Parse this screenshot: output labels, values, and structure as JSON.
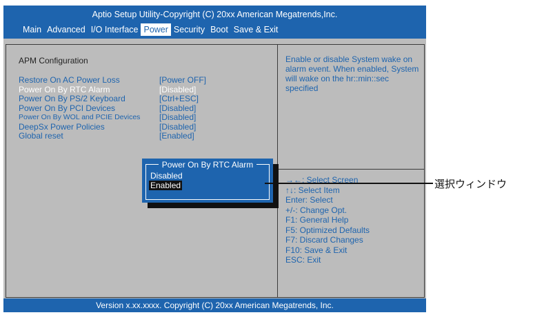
{
  "header": {
    "title": "Aptio Setup Utility-Copyright (C) 20xx American Megatrends,Inc.",
    "menu": [
      "Main",
      "Advanced",
      "I/O Interface",
      "Power",
      "Security",
      "Boot",
      "Save & Exit"
    ],
    "active_menu": "Power"
  },
  "main": {
    "section_title": "APM Configuration",
    "settings": [
      {
        "label": "Restore On AC Power Loss",
        "value": "[Power OFF]"
      },
      {
        "label": "Power On By RTC Alarm",
        "value": "[Disabled]",
        "highlighted": true
      },
      {
        "label": "Power On By PS/2 Keyboard",
        "value": "[Ctrl+ESC]"
      },
      {
        "label": "Power On By PCI Devices",
        "value": "[Disabled]"
      },
      {
        "label": "Power On By WOL and PCIE Devices",
        "value": "[Disabled]"
      },
      {
        "label": "DeepSx Power Policies",
        "value": "[Disabled]"
      },
      {
        "label": "Global reset",
        "value": "[Enabled]"
      }
    ]
  },
  "help": {
    "text": "Enable or disable System wake on alarm event. When enabled, System will wake on the hr::min::sec specified"
  },
  "keys": [
    "→←: Select Screen",
    "↑↓: Select Item",
    "Enter: Select",
    "+/-: Change Opt.",
    "F1: General Help",
    "F5: Optimized Defaults",
    "F7: Discard Changes",
    "F10: Save & Exit",
    "ESC: Exit"
  ],
  "popup": {
    "title": "Power On By RTC Alarm",
    "options": [
      "Disabled",
      "Enabled"
    ],
    "selected": "Enabled"
  },
  "footer": {
    "text": "Version x.xx.xxxx. Copyright (C) 20xx American Megatrends, Inc."
  },
  "callout": {
    "label": "選択ウィンドウ"
  },
  "colors": {
    "accent_blue": "#1e64ae",
    "panel_gray": "#bcbcbc"
  }
}
